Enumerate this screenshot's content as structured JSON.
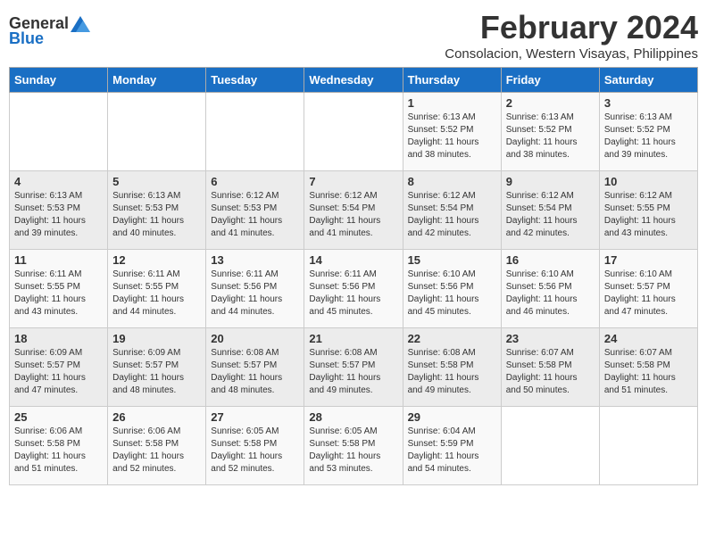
{
  "logo": {
    "general": "General",
    "blue": "Blue"
  },
  "title": "February 2024",
  "location": "Consolacion, Western Visayas, Philippines",
  "headers": [
    "Sunday",
    "Monday",
    "Tuesday",
    "Wednesday",
    "Thursday",
    "Friday",
    "Saturday"
  ],
  "weeks": [
    [
      {
        "day": "",
        "info": ""
      },
      {
        "day": "",
        "info": ""
      },
      {
        "day": "",
        "info": ""
      },
      {
        "day": "",
        "info": ""
      },
      {
        "day": "1",
        "info": "Sunrise: 6:13 AM\nSunset: 5:52 PM\nDaylight: 11 hours and 38 minutes."
      },
      {
        "day": "2",
        "info": "Sunrise: 6:13 AM\nSunset: 5:52 PM\nDaylight: 11 hours and 38 minutes."
      },
      {
        "day": "3",
        "info": "Sunrise: 6:13 AM\nSunset: 5:52 PM\nDaylight: 11 hours and 39 minutes."
      }
    ],
    [
      {
        "day": "4",
        "info": "Sunrise: 6:13 AM\nSunset: 5:53 PM\nDaylight: 11 hours and 39 minutes."
      },
      {
        "day": "5",
        "info": "Sunrise: 6:13 AM\nSunset: 5:53 PM\nDaylight: 11 hours and 40 minutes."
      },
      {
        "day": "6",
        "info": "Sunrise: 6:12 AM\nSunset: 5:53 PM\nDaylight: 11 hours and 41 minutes."
      },
      {
        "day": "7",
        "info": "Sunrise: 6:12 AM\nSunset: 5:54 PM\nDaylight: 11 hours and 41 minutes."
      },
      {
        "day": "8",
        "info": "Sunrise: 6:12 AM\nSunset: 5:54 PM\nDaylight: 11 hours and 42 minutes."
      },
      {
        "day": "9",
        "info": "Sunrise: 6:12 AM\nSunset: 5:54 PM\nDaylight: 11 hours and 42 minutes."
      },
      {
        "day": "10",
        "info": "Sunrise: 6:12 AM\nSunset: 5:55 PM\nDaylight: 11 hours and 43 minutes."
      }
    ],
    [
      {
        "day": "11",
        "info": "Sunrise: 6:11 AM\nSunset: 5:55 PM\nDaylight: 11 hours and 43 minutes."
      },
      {
        "day": "12",
        "info": "Sunrise: 6:11 AM\nSunset: 5:55 PM\nDaylight: 11 hours and 44 minutes."
      },
      {
        "day": "13",
        "info": "Sunrise: 6:11 AM\nSunset: 5:56 PM\nDaylight: 11 hours and 44 minutes."
      },
      {
        "day": "14",
        "info": "Sunrise: 6:11 AM\nSunset: 5:56 PM\nDaylight: 11 hours and 45 minutes."
      },
      {
        "day": "15",
        "info": "Sunrise: 6:10 AM\nSunset: 5:56 PM\nDaylight: 11 hours and 45 minutes."
      },
      {
        "day": "16",
        "info": "Sunrise: 6:10 AM\nSunset: 5:56 PM\nDaylight: 11 hours and 46 minutes."
      },
      {
        "day": "17",
        "info": "Sunrise: 6:10 AM\nSunset: 5:57 PM\nDaylight: 11 hours and 47 minutes."
      }
    ],
    [
      {
        "day": "18",
        "info": "Sunrise: 6:09 AM\nSunset: 5:57 PM\nDaylight: 11 hours and 47 minutes."
      },
      {
        "day": "19",
        "info": "Sunrise: 6:09 AM\nSunset: 5:57 PM\nDaylight: 11 hours and 48 minutes."
      },
      {
        "day": "20",
        "info": "Sunrise: 6:08 AM\nSunset: 5:57 PM\nDaylight: 11 hours and 48 minutes."
      },
      {
        "day": "21",
        "info": "Sunrise: 6:08 AM\nSunset: 5:57 PM\nDaylight: 11 hours and 49 minutes."
      },
      {
        "day": "22",
        "info": "Sunrise: 6:08 AM\nSunset: 5:58 PM\nDaylight: 11 hours and 49 minutes."
      },
      {
        "day": "23",
        "info": "Sunrise: 6:07 AM\nSunset: 5:58 PM\nDaylight: 11 hours and 50 minutes."
      },
      {
        "day": "24",
        "info": "Sunrise: 6:07 AM\nSunset: 5:58 PM\nDaylight: 11 hours and 51 minutes."
      }
    ],
    [
      {
        "day": "25",
        "info": "Sunrise: 6:06 AM\nSunset: 5:58 PM\nDaylight: 11 hours and 51 minutes."
      },
      {
        "day": "26",
        "info": "Sunrise: 6:06 AM\nSunset: 5:58 PM\nDaylight: 11 hours and 52 minutes."
      },
      {
        "day": "27",
        "info": "Sunrise: 6:05 AM\nSunset: 5:58 PM\nDaylight: 11 hours and 52 minutes."
      },
      {
        "day": "28",
        "info": "Sunrise: 6:05 AM\nSunset: 5:58 PM\nDaylight: 11 hours and 53 minutes."
      },
      {
        "day": "29",
        "info": "Sunrise: 6:04 AM\nSunset: 5:59 PM\nDaylight: 11 hours and 54 minutes."
      },
      {
        "day": "",
        "info": ""
      },
      {
        "day": "",
        "info": ""
      }
    ]
  ]
}
